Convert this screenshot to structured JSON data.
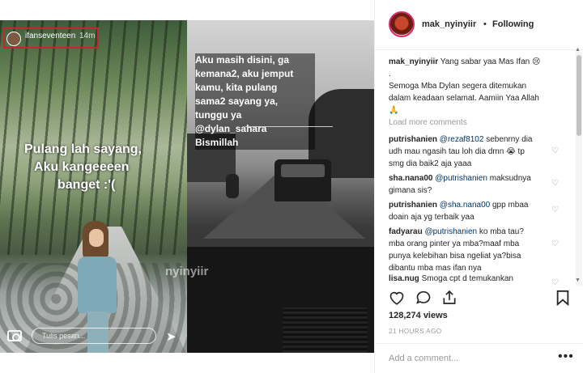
{
  "story_left": {
    "username": "ifanseventeen",
    "time": "14m",
    "text_lines": [
      "Pulang lah sayang,",
      "Aku kangeeeen",
      "banget :'(",
      "reply_placeholder"
    ],
    "reply_placeholder": "Tulis pesan...",
    "watermark": "nyinyiir"
  },
  "story_right": {
    "text_lines": [
      "Aku masih disini, ga",
      "kemana2, aku jemput",
      "kamu, kita pulang",
      "sama2 sayang ya,",
      "tunggu ya",
      "@dylan_sahara",
      "Bismillah"
    ]
  },
  "header": {
    "username": "mak_nyinyiir",
    "separator": "•",
    "follow_label": "Following"
  },
  "caption": {
    "user": "mak_nyinyiir",
    "line1": "Yang sabar yaa Mas Ifan 😢",
    "line2": ".",
    "line3": "Semoga Mba Dylan segera ditemukan",
    "line4": "dalam keadaan selamat. Aamiin Yaa Allah",
    "line5": "🙏"
  },
  "load_more": "Load more comments",
  "comments": [
    {
      "user": "putrishanien",
      "mention": "@rezaf8102",
      "l1": "sebenrny dia",
      "l2": "udh mau ngasih tau loh dia dmn 😭 tp",
      "l3": "smg dia baik2 aja yaaa"
    },
    {
      "user": "sha.nana00",
      "mention": "@putrishanien",
      "l1": "maksudnya",
      "l2": "gimana sis?"
    },
    {
      "user": "putrishanien",
      "mention": "@sha.nana00",
      "l1": "gpp mbaa",
      "l2": "doain aja yg terbaik yaa"
    },
    {
      "user": "fadyarau",
      "mention": "@putrishanien",
      "l1": "ko mba tau?",
      "l2": "mba orang pinter ya mba?maaf mba",
      "l3": "punya kelebihan bisa ngeliat ya?bisa",
      "l4": "dibantu mba mas ifan nya"
    },
    {
      "user": "lisa.nug",
      "l1": "Smoga cpt d temukankan"
    }
  ],
  "actions": {
    "like": "heart-outline",
    "comment": "speech-bubble",
    "share": "share-arrow",
    "save": "bookmark"
  },
  "views": "128,274 views",
  "time_ago": "21 HOURS AGO",
  "add_comment_placeholder": "Add a comment...",
  "more": "•••"
}
